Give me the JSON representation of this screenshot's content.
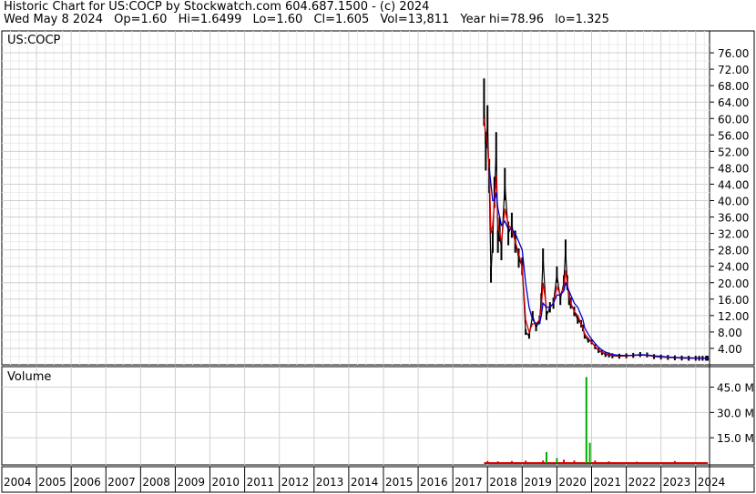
{
  "header": {
    "title": "Historic Chart for US:COCP by Stockwatch.com 604.687.1500 - (c) 2024",
    "date": "Wed May  8 2024",
    "open": "Op=1.60",
    "high": "Hi=1.6499",
    "low": "Lo=1.60",
    "close": "Cl=1.605",
    "volume": "Vol=13,811",
    "year_high": "Year hi=78.96",
    "year_low": "lo=1.325"
  },
  "chart_data": [
    {
      "type": "line",
      "title": "US:COCP",
      "ylim": [
        0,
        80
      ],
      "yticks": [
        "76.00",
        "72.00",
        "68.00",
        "64.00",
        "60.00",
        "56.00",
        "52.00",
        "48.00",
        "44.00",
        "40.00",
        "36.00",
        "32.00",
        "28.00",
        "24.00",
        "20.00",
        "16.00",
        "12.00",
        "8.00",
        "4.00"
      ],
      "x_ticks": [
        "2004",
        "2005",
        "2006",
        "2007",
        "2008",
        "2009",
        "2010",
        "2011",
        "2012",
        "2013",
        "2014",
        "2015",
        "2016",
        "2017",
        "2018",
        "2019",
        "2020",
        "2021",
        "2022",
        "2023",
        "2024"
      ],
      "grid": true,
      "colors": {
        "price": "#000000",
        "ma_short": "#dd0000",
        "ma_long": "#0000cc",
        "grid": "#d0d0d0"
      },
      "series": [
        {
          "x": [
            2017.9,
            2017.95,
            2018.0,
            2018.05,
            2018.1,
            2018.15,
            2018.2,
            2018.25,
            2018.3,
            2018.35,
            2018.4,
            2018.5,
            2018.6,
            2018.7,
            2018.8,
            2018.9,
            2019.0,
            2019.1,
            2019.2,
            2019.3,
            2019.4,
            2019.5,
            2019.55,
            2019.6,
            2019.7,
            2019.8,
            2019.9,
            2020.0,
            2020.1,
            2020.2,
            2020.25,
            2020.3,
            2020.35,
            2020.4,
            2020.5,
            2020.6,
            2020.7,
            2020.75,
            2020.8,
            2020.9,
            2021.0,
            2021.1,
            2021.2,
            2021.3,
            2021.4,
            2021.5,
            2021.6,
            2021.8,
            2022.0,
            2022.2,
            2022.4,
            2022.6,
            2022.8,
            2023.0,
            2023.2,
            2023.4,
            2023.6,
            2023.8,
            2024.0,
            2024.1,
            2024.2,
            2024.3,
            2024.35
          ],
          "values": [
            64,
            52,
            58,
            46,
            22,
            30,
            42,
            52,
            30,
            33,
            28,
            44,
            32,
            34,
            30,
            26,
            24,
            8,
            7,
            12,
            9,
            11,
            16,
            26,
            12,
            14,
            15,
            22,
            16,
            20,
            28,
            20,
            16,
            15,
            13,
            11,
            10,
            9,
            7,
            6,
            5.6,
            4.4,
            3.5,
            3,
            2.5,
            2.4,
            2.2,
            2.1,
            2.2,
            2.3,
            2.5,
            2.4,
            2.0,
            1.9,
            1.8,
            1.7,
            1.65,
            1.6,
            1.6,
            1.6,
            1.605,
            1.605,
            1.605
          ]
        },
        {
          "values": [
            60,
            56,
            54,
            48,
            32,
            34,
            40,
            46,
            34,
            32,
            30,
            38,
            34,
            33,
            30,
            27,
            24,
            11,
            8,
            10,
            10,
            11,
            14,
            20,
            14,
            14,
            15,
            19,
            17,
            19,
            23,
            20,
            17,
            15,
            13,
            12,
            10,
            9,
            7.5,
            6.5,
            5.5,
            4.5,
            3.7,
            3.1,
            2.7,
            2.5,
            2.3,
            2.2,
            2.2,
            2.3,
            2.4,
            2.3,
            2.1,
            1.95,
            1.85,
            1.75,
            1.7,
            1.65,
            1.62,
            1.61,
            1.61,
            1.61,
            1.61
          ]
        },
        {
          "values": [
            null,
            null,
            null,
            48,
            44,
            40,
            40,
            42,
            38,
            36,
            34,
            35,
            33,
            33,
            32,
            30,
            28,
            20,
            14,
            11,
            10,
            10,
            12,
            15,
            14,
            14,
            15,
            17,
            17,
            18,
            20,
            19,
            18,
            17,
            15,
            14,
            12,
            11,
            9,
            7.5,
            6.3,
            5.2,
            4.3,
            3.6,
            3.1,
            2.8,
            2.5,
            2.3,
            2.3,
            2.3,
            2.4,
            2.4,
            2.2,
            2.05,
            1.9,
            1.8,
            1.75,
            1.7,
            1.66,
            1.64,
            1.63,
            1.62,
            1.62
          ]
        }
      ]
    },
    {
      "type": "bar",
      "title": "Volume",
      "ylim": [
        0,
        55
      ],
      "yticks": [
        "45.0 M",
        "30.0 M",
        "15.0 M"
      ],
      "colors": {
        "up": "#00aa00",
        "down": "#dd0000"
      },
      "series": [
        {
          "x": [
            2018.0,
            2018.3,
            2018.7,
            2019.1,
            2019.6,
            2019.7,
            2020.0,
            2020.2,
            2020.5,
            2020.85,
            2020.95,
            2021.1,
            2021.5,
            2022.3,
            2023.4
          ],
          "values": [
            1.2,
            1.0,
            1.2,
            1.4,
            1.5,
            6.5,
            3,
            2,
            1.5,
            51,
            12,
            1.5,
            1.0,
            0.8,
            1.2
          ],
          "direction": [
            "down",
            "down",
            "down",
            "down",
            "down",
            "up",
            "up",
            "down",
            "down",
            "up",
            "up",
            "down",
            "down",
            "down",
            "down"
          ]
        }
      ]
    }
  ]
}
